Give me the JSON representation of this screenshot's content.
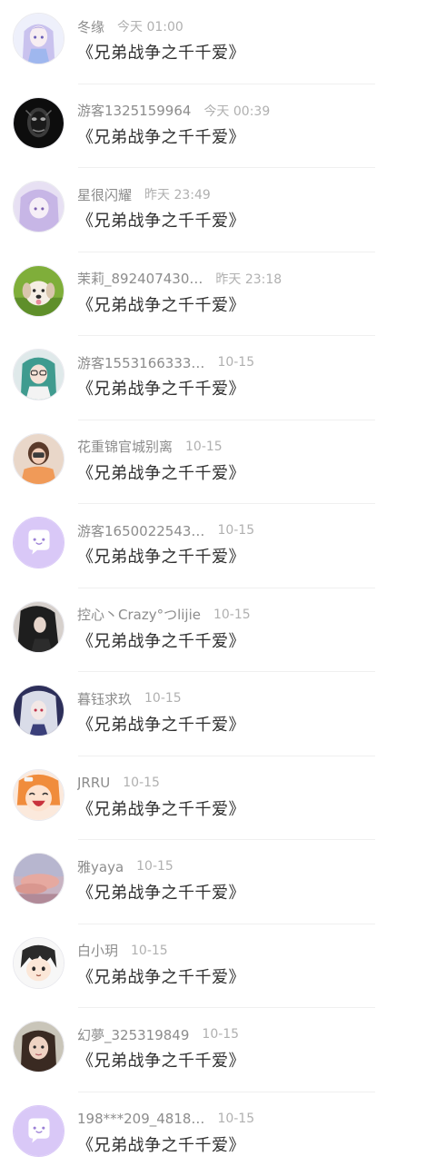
{
  "colors": {
    "name": "#8c8c8c",
    "time": "#b0b0b0",
    "title": "#2f2f2f",
    "divider": "#f0f0f0",
    "default_avatar": "#d9c8f7"
  },
  "rows": [
    {
      "name": "冬缘",
      "time": "今天 01:00",
      "title": "《兄弟战争之千千爱》",
      "avatar_icon": "anime-girl-avatar-icon"
    },
    {
      "name": "游客1325159964",
      "time": "今天 00:39",
      "title": "《兄弟战争之千千爱》",
      "avatar_icon": "dark-mask-avatar-icon"
    },
    {
      "name": "星很闪耀",
      "time": "昨天 23:49",
      "title": "《兄弟战争之千千爱》",
      "avatar_icon": "purple-anime-avatar-icon"
    },
    {
      "name": "茉莉_892407430…",
      "time": "昨天 23:18",
      "title": "《兄弟战争之千千爱》",
      "avatar_icon": "puppy-avatar-icon"
    },
    {
      "name": "游客1553166333…",
      "time": "10-15",
      "title": "《兄弟战争之千千爱》",
      "avatar_icon": "green-hair-avatar-icon"
    },
    {
      "name": "花重锦官城别离",
      "time": "10-15",
      "title": "《兄弟战争之千千爱》",
      "avatar_icon": "girl-photo-avatar-icon"
    },
    {
      "name": "游客1650022543…",
      "time": "10-15",
      "title": "《兄弟战争之千千爱》",
      "avatar_icon": "default-chat-avatar-icon"
    },
    {
      "name": "控心丶Crazy°つlijie",
      "time": "10-15",
      "title": "《兄弟战争之千千爱》",
      "avatar_icon": "dark-hair-avatar-icon"
    },
    {
      "name": "暮钰求玖",
      "time": "10-15",
      "title": "《兄弟战争之千千爱》",
      "avatar_icon": "white-hair-avatar-icon"
    },
    {
      "name": "JRRU",
      "time": "10-15",
      "title": "《兄弟战争之千千爱》",
      "avatar_icon": "laughing-anime-avatar-icon"
    },
    {
      "name": "雅yaya",
      "time": "10-15",
      "title": "《兄弟战争之千千爱》",
      "avatar_icon": "sky-avatar-icon"
    },
    {
      "name": "白小玥",
      "time": "10-15",
      "title": "《兄弟战争之千千爱》",
      "avatar_icon": "chibi-boy-avatar-icon"
    },
    {
      "name": "幻夢_325319849",
      "time": "10-15",
      "title": "《兄弟战争之千千爱》",
      "avatar_icon": "girl-selfie-avatar-icon"
    },
    {
      "name": "198***209_4818…",
      "time": "10-15",
      "title": "《兄弟战争之千千爱》",
      "avatar_icon": "default-chat-avatar-icon"
    }
  ]
}
